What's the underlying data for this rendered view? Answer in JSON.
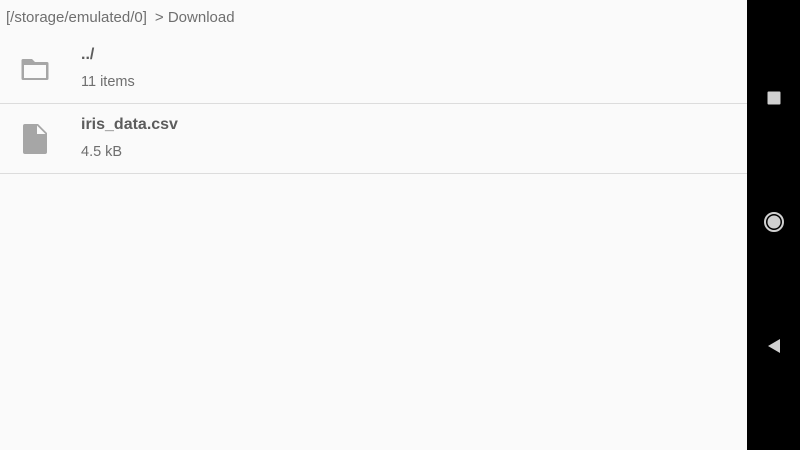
{
  "breadcrumb": {
    "root": "[/storage/emulated/0]",
    "current": "> Download"
  },
  "files": [
    {
      "name": "../",
      "meta": "11 items",
      "icon": "folder-icon"
    },
    {
      "name": "iris_data.csv",
      "meta": "4.5 kB",
      "icon": "file-icon"
    }
  ],
  "navbar": {
    "buttons": [
      "recents-icon",
      "home-icon",
      "back-icon"
    ]
  },
  "colors": {
    "background": "#fafafa",
    "text_primary": "#5c5c5c",
    "text_secondary": "#6e6e6e",
    "icon": "#a6a6a6",
    "divider": "#dcdcdc",
    "navbar": "#000000"
  }
}
